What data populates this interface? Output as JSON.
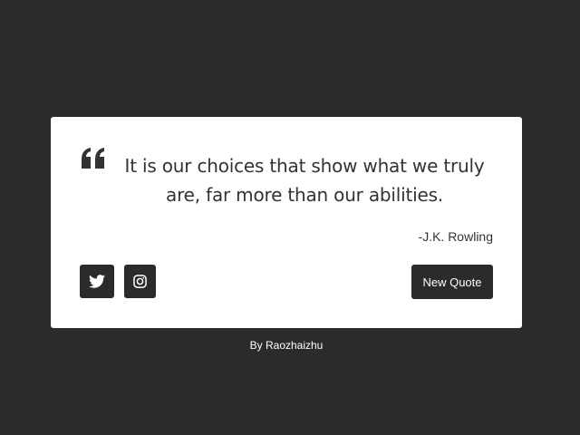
{
  "quote": {
    "text": "It is our choices that show what we truly are, far more than our abilities.",
    "author": "-J.K. Rowling",
    "quote_icon": "quote-left-icon"
  },
  "actions": {
    "twitter_icon": "twitter-icon",
    "instagram_icon": "instagram-icon",
    "new_quote_label": "New Quote"
  },
  "footer": {
    "credit": "By Raozhaizhu"
  },
  "colors": {
    "background": "#2b2b2b",
    "card": "#ffffff",
    "text": "#333333",
    "button": "#2b2b2b",
    "button_text": "#ffffff"
  }
}
